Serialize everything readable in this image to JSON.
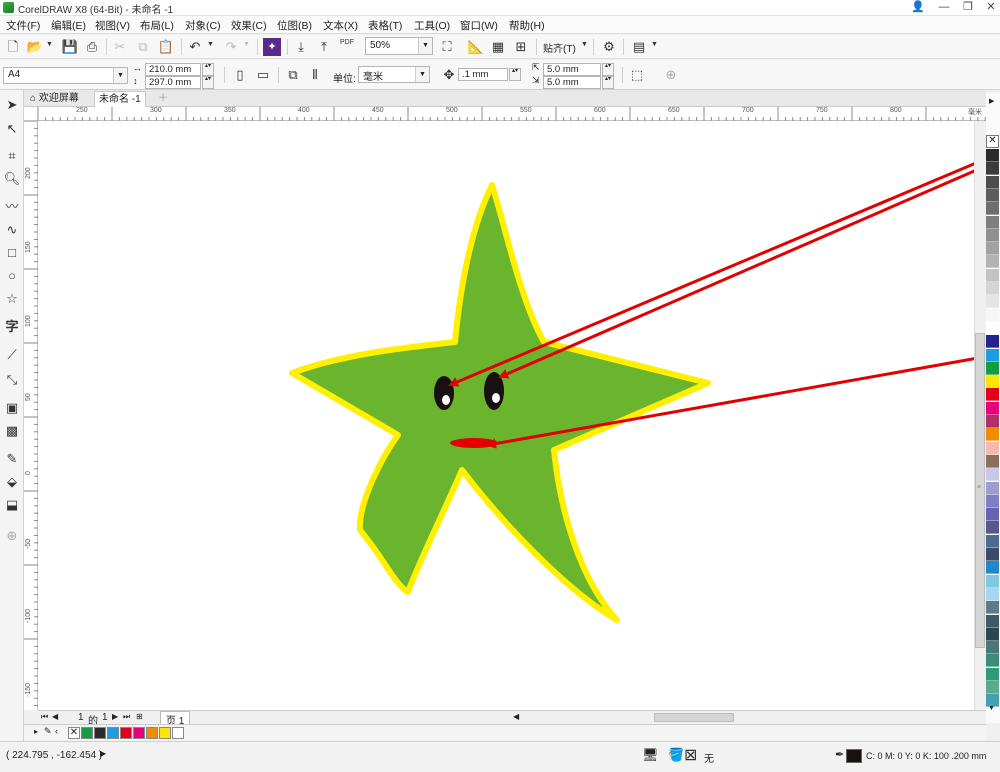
{
  "window": {
    "title": "CorelDRAW X8 (64-Bit) - 未命名 -1",
    "controls": [
      "👤",
      "—",
      "❐",
      "✕"
    ]
  },
  "menu": [
    "文件(F)",
    "编辑(E)",
    "视图(V)",
    "布局(L)",
    "对象(C)",
    "效果(C)",
    "位图(B)",
    "文本(X)",
    "表格(T)",
    "工具(O)",
    "窗口(W)",
    "帮助(H)"
  ],
  "toolbar": {
    "zoom": "50%",
    "snap_label": "贴齐(T)",
    "pdf_label": "PDF"
  },
  "property_bar": {
    "page_size": "A4",
    "width": "210.0 mm",
    "height": "297.0 mm",
    "units_label": "单位:",
    "units_value": "毫米",
    "nudge": ".1 mm",
    "dup_x": "5.0 mm",
    "dup_y": "5.0 mm"
  },
  "tabs": [
    {
      "label": "欢迎屏幕",
      "icon": "home-icon"
    },
    {
      "label": "未命名 -1"
    }
  ],
  "ruler": {
    "h_labels": [
      "250",
      "300",
      "350",
      "400",
      "450",
      "500",
      "550",
      "600",
      "650",
      "700",
      "750",
      "800"
    ],
    "h_unit": "毫米",
    "v_labels": [
      "200",
      "150",
      "100",
      "50",
      "0",
      "-50",
      "-100",
      "-150"
    ]
  },
  "page_nav": {
    "current": "1",
    "of_label": "的",
    "total": "1",
    "page_tab": "页 1"
  },
  "palette_colors": [
    "#2b2b2b",
    "#3b3b3b",
    "#4c4c4c",
    "#5d5d5d",
    "#6e6e6e",
    "#7f7f7f",
    "#909090",
    "#a1a1a1",
    "#b2b2b2",
    "#c3c3c3",
    "#d4d4d4",
    "#e5e5e5",
    "#f6f6f6",
    "#ffffff",
    "#23238f",
    "#1a9ee0",
    "#149c40",
    "#ffe500",
    "#e2001a",
    "#e5007d",
    "#b0306a",
    "#f08c00",
    "#f5b7b1",
    "#8b6f5e",
    "#c8c8e6",
    "#9c9cd0",
    "#7f7fc4",
    "#6464b4",
    "#57578e",
    "#4d6a90",
    "#3a4a6b",
    "#1e88c8",
    "#7ec8e3",
    "#a3d7ee",
    "#5c7c8a",
    "#3d5a66",
    "#2e4650",
    "#4a7878",
    "#3c8c78",
    "#2d9a78",
    "#5aaa8c",
    "#46a0b4"
  ],
  "doc_palette": [
    "#149c40",
    "#2b2b2b",
    "#1a9ee0",
    "#e2001a",
    "#e5007d",
    "#f08c00",
    "#ffe500",
    "#ffffff"
  ],
  "status": {
    "coords": "( 224.795 , -162.454 )",
    "fill_none": "无",
    "outline_info": "C: 0 M: 0 Y: 0 K: 100  .200 mm"
  },
  "drawing": {
    "star_fill": "#6ab42e",
    "star_outline": "#fff000",
    "arrow_color": "#e20000",
    "eye_color": "#1a1010",
    "mouth_color": "#e20000"
  }
}
